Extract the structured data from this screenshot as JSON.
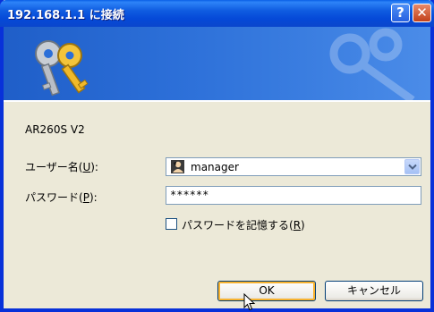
{
  "window": {
    "title": "192.168.1.1 に接続",
    "help_symbol": "?",
    "close_symbol": "✕"
  },
  "icons": {
    "banner": "keys-icon",
    "user": "user-icon",
    "dropdown": "chevron-down-icon",
    "cursor": "mouse-pointer-icon"
  },
  "colors": {
    "titlebar": "#0A5FE6",
    "frame_border": "#0831D9",
    "dialog_bg": "#ECE9D8",
    "default_button_glow": "#F8B330"
  },
  "dialog": {
    "server_name": "AR260S V2",
    "username_label": "ユーザー名(",
    "username_accel": "U",
    "username_suffix": "):",
    "username_value": "manager",
    "password_label": "パスワード(",
    "password_accel": "P",
    "password_suffix": "):",
    "password_value": "******",
    "remember_label": "パスワードを記憶する(",
    "remember_accel": "R",
    "remember_suffix": ")",
    "remember_checked": false,
    "ok_label": "OK",
    "cancel_label": "キャンセル"
  }
}
